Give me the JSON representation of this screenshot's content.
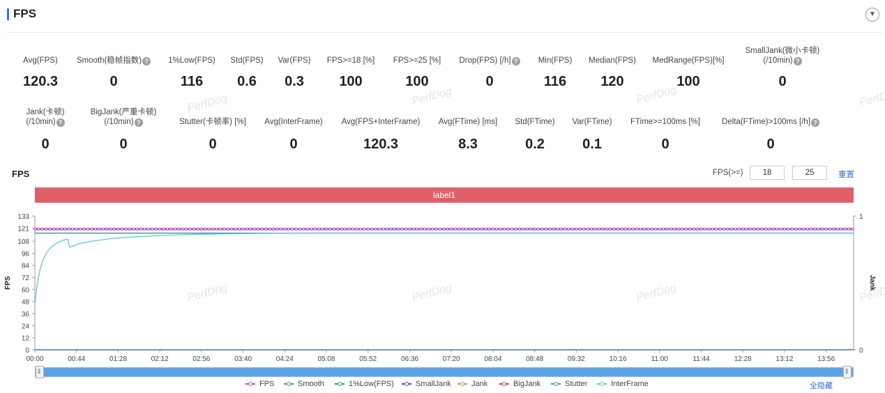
{
  "header": {
    "title": "FPS"
  },
  "metrics_row1": [
    {
      "label": "Avg(FPS)",
      "value": "120.3",
      "help": false,
      "cx": 58
    },
    {
      "label": "Smooth(稳帧指数)",
      "value": "0",
      "help": true,
      "cx": 163
    },
    {
      "label": "1%Low(FPS)",
      "value": "116",
      "help": false,
      "cx": 275
    },
    {
      "label": "Std(FPS)",
      "value": "0.6",
      "help": false,
      "cx": 354
    },
    {
      "label": "Var(FPS)",
      "value": "0.3",
      "help": false,
      "cx": 422
    },
    {
      "label": "FPS>=18 [%]",
      "value": "100",
      "help": false,
      "cx": 503
    },
    {
      "label": "FPS>=25 [%]",
      "value": "100",
      "help": false,
      "cx": 598
    },
    {
      "label": "Drop(FPS) [/h]",
      "value": "0",
      "help": true,
      "cx": 702
    },
    {
      "label": "Min(FPS)",
      "value": "116",
      "help": false,
      "cx": 796
    },
    {
      "label": "Median(FPS)",
      "value": "120",
      "help": false,
      "cx": 878
    },
    {
      "label": "MedRange(FPS)[%]",
      "value": "100",
      "help": false,
      "cx": 987
    },
    {
      "label": "SmallJank(微小卡顿)",
      "label2": "(/10min)",
      "value": "0",
      "help": true,
      "cx": 1122
    }
  ],
  "metrics_row2": [
    {
      "label": "Jank(卡顿)",
      "label2": "(/10min)",
      "value": "0",
      "help": true,
      "cx": 65
    },
    {
      "label": "BigJank(严重卡顿)",
      "label2": "(/10min)",
      "value": "0",
      "help": true,
      "cx": 177
    },
    {
      "label": "Stutter(卡顿率) [%]",
      "value": "0",
      "help": false,
      "cx": 305
    },
    {
      "label": "Avg(InterFrame)",
      "value": "0",
      "help": false,
      "cx": 421
    },
    {
      "label": "Avg(FPS+InterFrame)",
      "value": "120.3",
      "help": false,
      "cx": 546
    },
    {
      "label": "Avg(FTime) [ms]",
      "value": "8.3",
      "help": false,
      "cx": 671
    },
    {
      "label": "Std(FTime)",
      "value": "0.2",
      "help": false,
      "cx": 767
    },
    {
      "label": "Var(FTime)",
      "value": "0.1",
      "help": false,
      "cx": 849
    },
    {
      "label": "FTime>=100ms [%]",
      "value": "0",
      "help": false,
      "cx": 954
    },
    {
      "label": "Delta(FTime)>100ms [/h]",
      "value": "0",
      "help": true,
      "cx": 1105
    }
  ],
  "watermark": "PerfDog",
  "chart_section": {
    "title": "FPS",
    "threshold_label": "FPS(>=)",
    "threshold_1": "18",
    "threshold_2": "25",
    "reset_label": "重置",
    "band_label": "label1",
    "hide_all_label": "全隐藏"
  },
  "chart_data": {
    "type": "line",
    "ylabel": "FPS",
    "y2label": "Jank",
    "ylim": [
      0,
      133
    ],
    "yticks": [
      0,
      12,
      24,
      36,
      48,
      60,
      72,
      84,
      96,
      108,
      121,
      133
    ],
    "y2ticks": [
      "0",
      "1"
    ],
    "xticks": [
      "00:00",
      "00:44",
      "01:28",
      "02:12",
      "02:56",
      "03:40",
      "04:24",
      "05:08",
      "05:52",
      "06:36",
      "07:20",
      "08:04",
      "08:48",
      "09:32",
      "10:16",
      "11:00",
      "11:44",
      "12:28",
      "13:12",
      "13:56"
    ],
    "duration_s": 865,
    "series": [
      {
        "name": "FPS",
        "color": "#b44fc4",
        "x": [
          0,
          865
        ],
        "y": [
          120,
          120
        ]
      },
      {
        "name": "Smooth",
        "color": "#3aa65a",
        "x": [
          0,
          865
        ],
        "y": [
          0,
          0
        ]
      },
      {
        "name": "1%Low(FPS)",
        "color": "#2a9a8a",
        "x": [
          0,
          865
        ],
        "y": [
          116,
          116
        ]
      },
      {
        "name": "SmallJank",
        "color": "#4b4fc8",
        "x": [
          0,
          865
        ],
        "y": [
          0,
          0
        ]
      },
      {
        "name": "Jank",
        "color": "#f08a3c",
        "x": [
          0,
          865
        ],
        "y": [
          0,
          0
        ]
      },
      {
        "name": "BigJank",
        "color": "#d9453d",
        "x": [
          0,
          865
        ],
        "y": [
          0,
          0
        ]
      },
      {
        "name": "Stutter",
        "color": "#4a90e2",
        "x": [
          0,
          865
        ],
        "y": [
          0,
          0
        ]
      },
      {
        "name": "InterFrame",
        "color": "#5ccad6",
        "x": [
          0,
          2,
          5,
          8,
          12,
          16,
          20,
          25,
          30,
          35,
          36,
          37,
          45,
          60,
          80,
          100,
          130,
          160,
          200,
          250,
          300,
          350,
          400,
          500,
          600,
          700,
          865
        ],
        "y": [
          46,
          62,
          78,
          88,
          96,
          101,
          104,
          107,
          109,
          110,
          104,
          102,
          105,
          108,
          110.5,
          112,
          113.5,
          114.5,
          115.3,
          115.8,
          116,
          116,
          116,
          116,
          116,
          116,
          116
        ]
      }
    ],
    "legend": [
      "FPS",
      "Smooth",
      "1%Low(FPS)",
      "SmallJank",
      "Jank",
      "BigJank",
      "Stutter",
      "InterFrame"
    ],
    "legend_position": "bottom"
  }
}
